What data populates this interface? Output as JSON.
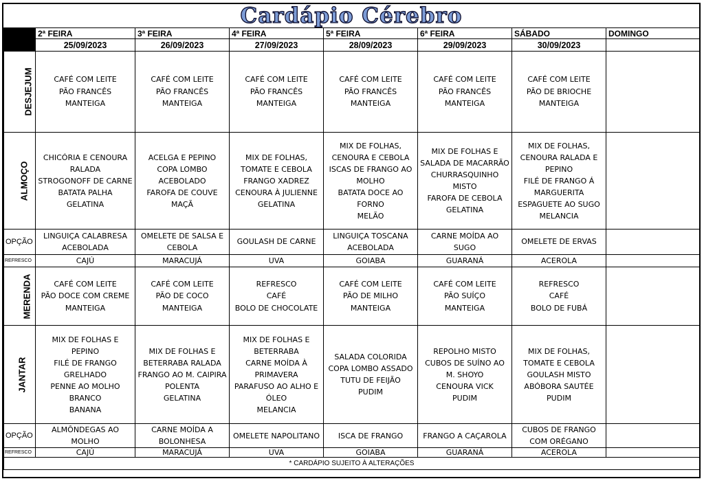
{
  "title": "Cardápio Cérebro",
  "days": [
    {
      "name": "2ª FEIRA",
      "date": "25/09/2023"
    },
    {
      "name": "3ª FEIRA",
      "date": "26/09/2023"
    },
    {
      "name": "4ª FEIRA",
      "date": "27/09/2023"
    },
    {
      "name": "5ª FEIRA",
      "date": "28/09/2023"
    },
    {
      "name": "6ª FEIRA",
      "date": "29/09/2023"
    },
    {
      "name": "SÁBADO",
      "date": "30/09/2023"
    },
    {
      "name": "DOMINGO",
      "date": ""
    }
  ],
  "labels": {
    "desjejum": "DESJEJUM",
    "almoco": "ALMOÇO",
    "opcao": "OPÇÃO",
    "refresco": "REFRESCO",
    "merenda": "MERENDA",
    "jantar": "JANTAR"
  },
  "desjejum": [
    [
      "CAFÉ COM LEITE",
      "PÃO FRANCÊS",
      "MANTEIGA"
    ],
    [
      "CAFÉ COM LEITE",
      "PÃO FRANCÊS",
      "MANTEIGA"
    ],
    [
      "CAFÉ COM LEITE",
      "PÃO FRANCÊS",
      "MANTEIGA"
    ],
    [
      "CAFÉ COM LEITE",
      "PÃO FRANCÊS",
      "MANTEIGA"
    ],
    [
      "CAFÉ COM LEITE",
      "PÃO FRANCÊS",
      "MANTEIGA"
    ],
    [
      "CAFÉ COM LEITE",
      "PÃO DE BRIOCHE",
      "MANTEIGA"
    ],
    []
  ],
  "almoco": [
    [
      "CHICÓRIA E CENOURA",
      "RALADA",
      "STROGONOFF DE CARNE",
      "BATATA PALHA",
      "GELATINA"
    ],
    [
      "ACELGA E PEPINO",
      "COPA LOMBO",
      "ACEBOLADO",
      "FAROFA DE COUVE",
      "MAÇÃ"
    ],
    [
      "MIX DE FOLHAS,",
      "TOMATE E CEBOLA",
      "FRANGO XADREZ",
      "CENOURA À JULIENNE",
      "GELATINA"
    ],
    [
      "MIX DE FOLHAS,",
      "CENOURA E CEBOLA",
      "ISCAS DE FRANGO AO",
      "MOLHO",
      "BATATA DOCE  AO",
      "FORNO",
      "MELÃO"
    ],
    [
      "MIX DE FOLHAS E",
      "SALADA DE MACARRÃO",
      "CHURRASQUINHO",
      "MISTO",
      "FAROFA DE CEBOLA",
      "GELATINA"
    ],
    [
      "MIX DE FOLHAS,",
      "CENOURA RALADA E",
      "PEPINO",
      "FILÉ DE FRANGO Á",
      "MARGUERITA",
      "ESPAGUETE AO SUGO",
      "MELANCIA"
    ],
    []
  ],
  "opcao_almoco": [
    [
      "LINGUIÇA CALABRESA",
      "ACEBOLADA"
    ],
    [
      "OMELETE DE SALSA E",
      "CEBOLA"
    ],
    [
      "GOULASH DE CARNE"
    ],
    [
      "LINGUIÇA TOSCANA",
      "ACEBOLADA"
    ],
    [
      "CARNE MOÍDA AO",
      "SUGO"
    ],
    [
      "OMELETE DE ERVAS"
    ],
    []
  ],
  "refresco_almoco": [
    "CAJÚ",
    "MARACUJÁ",
    "UVA",
    "GOIABA",
    "GUARANÁ",
    "ACEROLA",
    ""
  ],
  "merenda": [
    [
      "CAFÉ COM LEITE",
      "PÃO DOCE COM CREME",
      "MANTEIGA"
    ],
    [
      "CAFÉ COM LEITE",
      "PÃO DE COCO",
      "MANTEIGA"
    ],
    [
      "REFRESCO",
      "CAFÉ",
      "BOLO DE CHOCOLATE"
    ],
    [
      "CAFÉ COM LEITE",
      "PÃO DE MILHO",
      "MANTEIGA"
    ],
    [
      "CAFÉ COM LEITE",
      "PÃO SUÍÇO",
      "MANTEIGA"
    ],
    [
      "REFRESCO",
      "CAFÉ",
      "BOLO DE FUBÁ"
    ],
    []
  ],
  "jantar": [
    [
      "MIX DE FOLHAS E",
      "PEPINO",
      "FILÉ DE FRANGO",
      "GRELHADO",
      "PENNE AO MOLHO",
      "BRANCO",
      "BANANA"
    ],
    [
      "MIX DE FOLHAS E",
      "BETERRABA RALADA",
      "FRANGO AO M. CAIPIRA",
      "POLENTA",
      "GELATINA"
    ],
    [
      "MIX DE FOLHAS E",
      "BETERRABA",
      "CARNE MOÍDA À",
      "PRIMAVERA",
      "PARAFUSO AO ALHO E",
      "ÓLEO",
      "MELANCIA"
    ],
    [
      "SALADA COLORIDA",
      "COPA LOMBO ASSADO",
      "TUTU  DE FEIJÃO",
      "PUDIM"
    ],
    [
      "REPOLHO MISTO",
      "CUBOS DE SUÍNO AO",
      "M. SHOYO",
      "CENOURA VICK",
      "PUDIM"
    ],
    [
      "MIX DE FOLHAS,",
      "TOMATE E CEBOLA",
      "GOULASH MISTO",
      "ABÓBORA SAUTÉE",
      "PUDIM"
    ],
    []
  ],
  "opcao_jantar": [
    [
      "ALMÔNDEGAS AO",
      "MOLHO"
    ],
    [
      "CARNE MOÍDA A",
      "BOLONHESA"
    ],
    [
      "OMELETE NAPOLITANO"
    ],
    [
      "ISCA DE FRANGO"
    ],
    [
      "FRANGO A CAÇAROLA"
    ],
    [
      "CUBOS DE FRANGO",
      "COM ORÉGANO"
    ],
    []
  ],
  "refresco_jantar": [
    "CAJÚ",
    "MARACUJÁ",
    "UVA",
    "GOIABA",
    "GUARANÁ",
    "ACEROLA",
    ""
  ],
  "footer": "* CARDÁPIO SUJEITO À ALTERAÇÕES"
}
